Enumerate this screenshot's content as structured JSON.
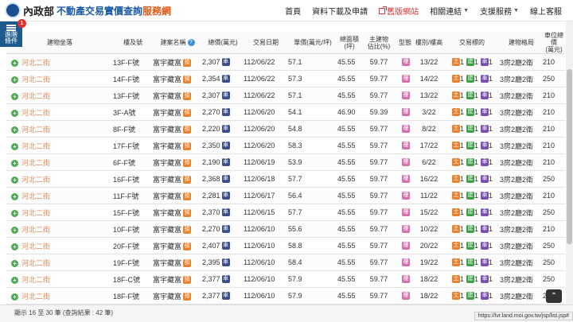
{
  "header": {
    "ministry": "內政部",
    "title_main": "不動產交易實價查詢",
    "title_accent": "服務網",
    "nav": [
      {
        "label": "首頁"
      },
      {
        "label": "資料下載及申請"
      },
      {
        "label": "舊版網站"
      },
      {
        "label": "相關連結"
      },
      {
        "label": "支援服務"
      },
      {
        "label": "線上客服"
      }
    ]
  },
  "filter": {
    "label_line1": "進階",
    "label_line2": "條件",
    "badge": "1"
  },
  "columns": [
    "建物坐落",
    "樓及號",
    "建案名稱",
    "總價(萬元)",
    "交易日期",
    "單價(萬元/坪)",
    "總面積\n(坪)",
    "主建物\n佔比(%)",
    "型態",
    "樓別/樓高",
    "交易標的",
    "建物格局",
    "車位總價\n(萬元)"
  ],
  "icons": {
    "tag_parking": "車",
    "tag_build": "預",
    "tag_type": "樓",
    "txn_land": "土",
    "txn_build": "建",
    "txn_park": "車",
    "help": "?",
    "plus": "+"
  },
  "rows": [
    {
      "addr": "河北二街",
      "floor": "13F-F號",
      "project": "富宇藏富",
      "price": "2,307",
      "date": "112/06/22",
      "unit": "57.1",
      "area": "45.55",
      "ratio": "59.77",
      "level": "13/22",
      "txn": [
        "1",
        "1",
        "1"
      ],
      "layout": "3房2廳2衛",
      "parking": "210"
    },
    {
      "addr": "河北二街",
      "floor": "14F-F號",
      "project": "富宇藏富",
      "price": "2,354",
      "date": "112/06/22",
      "unit": "57.3",
      "area": "45.55",
      "ratio": "59.77",
      "level": "14/22",
      "txn": [
        "1",
        "1",
        "1"
      ],
      "layout": "3房2廳2衛",
      "parking": "250"
    },
    {
      "addr": "河北二街",
      "floor": "13F-F號",
      "project": "富宇藏富",
      "price": "2,307",
      "date": "112/06/22",
      "unit": "57.1",
      "area": "45.55",
      "ratio": "59.77",
      "level": "13/22",
      "txn": [
        "1",
        "1",
        "1"
      ],
      "layout": "3房2廳2衛",
      "parking": "210"
    },
    {
      "addr": "河北二街",
      "floor": "3F-A號",
      "project": "富宇藏富",
      "price": "2,270",
      "date": "112/06/20",
      "unit": "54.1",
      "area": "46.90",
      "ratio": "59.39",
      "level": "3/22",
      "txn": [
        "1",
        "1",
        "1"
      ],
      "layout": "3房2廳2衛",
      "parking": "210"
    },
    {
      "addr": "河北二街",
      "floor": "8F-F號",
      "project": "富宇藏富",
      "price": "2,220",
      "date": "112/06/20",
      "unit": "54.8",
      "area": "45.55",
      "ratio": "59.77",
      "level": "8/22",
      "txn": [
        "1",
        "1",
        "1"
      ],
      "layout": "3房2廳2衛",
      "parking": "210"
    },
    {
      "addr": "河北二街",
      "floor": "17F-F號",
      "project": "富宇藏富",
      "price": "2,350",
      "date": "112/06/20",
      "unit": "58.3",
      "area": "45.55",
      "ratio": "59.77",
      "level": "17/22",
      "txn": [
        "1",
        "1",
        "1"
      ],
      "layout": "3房2廳2衛",
      "parking": "210"
    },
    {
      "addr": "河北二街",
      "floor": "6F-F號",
      "project": "富宇藏富",
      "price": "2,190",
      "date": "112/06/19",
      "unit": "53.9",
      "area": "45.55",
      "ratio": "59.77",
      "level": "6/22",
      "txn": [
        "1",
        "1",
        "1"
      ],
      "layout": "3房2廳2衛",
      "parking": "210"
    },
    {
      "addr": "河北二街",
      "floor": "16F-F號",
      "project": "富宇藏富",
      "price": "2,368",
      "date": "112/06/18",
      "unit": "57.7",
      "area": "45.55",
      "ratio": "59.77",
      "level": "16/22",
      "txn": [
        "1",
        "1",
        "1"
      ],
      "layout": "3房2廳2衛",
      "parking": "250"
    },
    {
      "addr": "河北二街",
      "floor": "11F-F號",
      "project": "富宇藏富",
      "price": "2,281",
      "date": "112/06/17",
      "unit": "56.4",
      "area": "45.55",
      "ratio": "59.77",
      "level": "11/22",
      "txn": [
        "1",
        "1",
        "1"
      ],
      "layout": "3房2廳2衛",
      "parking": "210"
    },
    {
      "addr": "河北二街",
      "floor": "15F-F號",
      "project": "富宇藏富",
      "price": "2,370",
      "date": "112/06/15",
      "unit": "57.7",
      "area": "45.55",
      "ratio": "59.77",
      "level": "15/22",
      "txn": [
        "1",
        "1",
        "1"
      ],
      "layout": "3房2廳2衛",
      "parking": "250"
    },
    {
      "addr": "河北二街",
      "floor": "10F-F號",
      "project": "富宇藏富",
      "price": "2,270",
      "date": "112/06/10",
      "unit": "55.6",
      "area": "45.55",
      "ratio": "59.77",
      "level": "10/22",
      "txn": [
        "1",
        "1",
        "1"
      ],
      "layout": "3房2廳2衛",
      "parking": "210"
    },
    {
      "addr": "河北二街",
      "floor": "20F-F號",
      "project": "富宇藏富",
      "price": "2,407",
      "date": "112/06/10",
      "unit": "58.8",
      "area": "45.55",
      "ratio": "59.77",
      "level": "20/22",
      "txn": [
        "1",
        "1",
        "1"
      ],
      "layout": "3房2廳2衛",
      "parking": "250"
    },
    {
      "addr": "河北二街",
      "floor": "19F-F號",
      "project": "富宇藏富",
      "price": "2,395",
      "date": "112/06/10",
      "unit": "58.4",
      "area": "45.55",
      "ratio": "59.77",
      "level": "19/22",
      "txn": [
        "1",
        "1",
        "1"
      ],
      "layout": "3房2廳2衛",
      "parking": "250"
    },
    {
      "addr": "河北二街",
      "floor": "18F-C號",
      "project": "富宇藏富",
      "price": "2,377",
      "date": "112/06/10",
      "unit": "57.9",
      "area": "45.55",
      "ratio": "59.77",
      "level": "18/22",
      "txn": [
        "1",
        "1",
        "1"
      ],
      "layout": "3房2廳2衛",
      "parking": "250"
    },
    {
      "addr": "河北二街",
      "floor": "18F-F號",
      "project": "富宇藏富",
      "price": "2,377",
      "date": "112/06/10",
      "unit": "57.9",
      "area": "45.55",
      "ratio": "59.77",
      "level": "18/22",
      "txn": [
        "1",
        "1",
        "1"
      ],
      "layout": "3房2廳2衛",
      "parking": "250"
    }
  ],
  "footer": {
    "summary": "顯示 16 至 30 筆 (查詢結果 : 42 筆)",
    "status_url": "https://lvr.land.moi.gov.tw/jsp/list.jsp#",
    "to_top": "⌃"
  }
}
